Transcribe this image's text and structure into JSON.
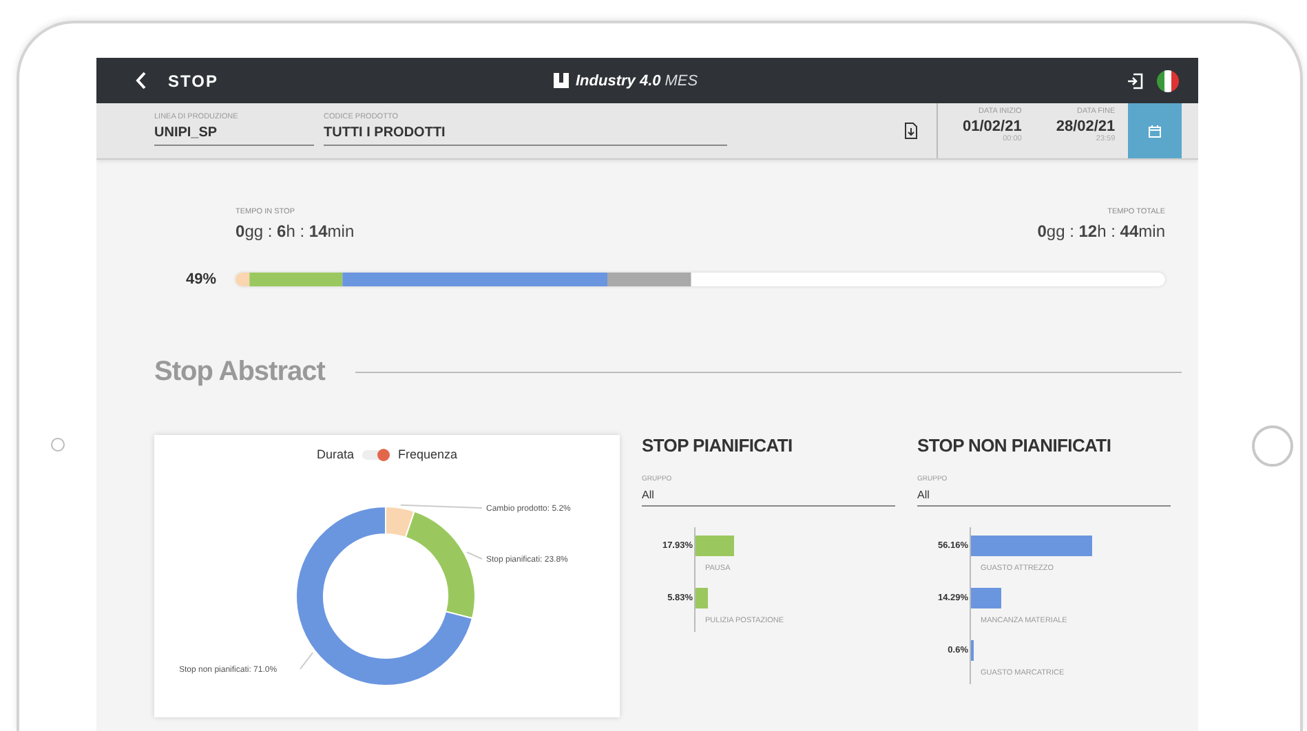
{
  "header": {
    "title": "STOP",
    "app_name": "Industry 4.0",
    "app_suffix": "MES"
  },
  "filters": {
    "fields": [
      {
        "label": "LINEA DI PRODUZIONE",
        "value": "UNIPI_SP"
      },
      {
        "label": "CODICE PRODOTTO",
        "value": "TUTTI I PRODOTTI"
      }
    ],
    "dates": [
      {
        "label": "DATA INIZIO",
        "date": "01/02/21",
        "time": "00:00"
      },
      {
        "label": "DATA FINE",
        "date": "28/02/21",
        "time": "23:59"
      }
    ]
  },
  "summary": {
    "stop_time": {
      "label": "TEMPO IN STOP",
      "value": "**0**gg : **6**h : **14**min"
    },
    "total_time": {
      "label": "TEMPO TOTALE",
      "value": "**0**gg : **12**h : **44**min"
    },
    "percent": "49%"
  },
  "abstract": {
    "title": "Stop Abstract",
    "chart_card": {
      "toggle": {
        "left_label": "Durata",
        "right_label": "Frequenza",
        "on": true
      },
      "chart_data": {
        "type": "donut",
        "series": [
          {
            "values": [
              5.2,
              23.8,
              71.0
            ]
          }
        ],
        "value_labels": [
          "Cambio prodotto: 5.2%",
          "Stop pianificati: 23.8%",
          "Stop non pianificati: 71.0%"
        ]
      }
    },
    "panels": [
      {
        "title": "STOP PIANIFICATI",
        "group_label": "GRUPPO",
        "group_value": "All",
        "color": "#9bc85e",
        "items": [
          {
            "value": "17.93%",
            "level": 0.1793,
            "label": "PAUSA"
          },
          {
            "value": "5.83%",
            "level": 0.0583,
            "label": "PULIZIA POSTAZIONE"
          }
        ]
      },
      {
        "title": "STOP NON PIANIFICATI",
        "group_label": "GRUPPO",
        "group_value": "All",
        "color": "#6a96e0",
        "items": [
          {
            "value": "56.16%",
            "level": 0.5616,
            "label": "GUASTO ATTREZZO"
          },
          {
            "value": "14.29%",
            "level": 0.1429,
            "label": "MANCANZA MATERIALE"
          },
          {
            "value": "0.6%",
            "level": 0.006,
            "label": "GUASTO MARCATRICE"
          }
        ]
      }
    ]
  }
}
